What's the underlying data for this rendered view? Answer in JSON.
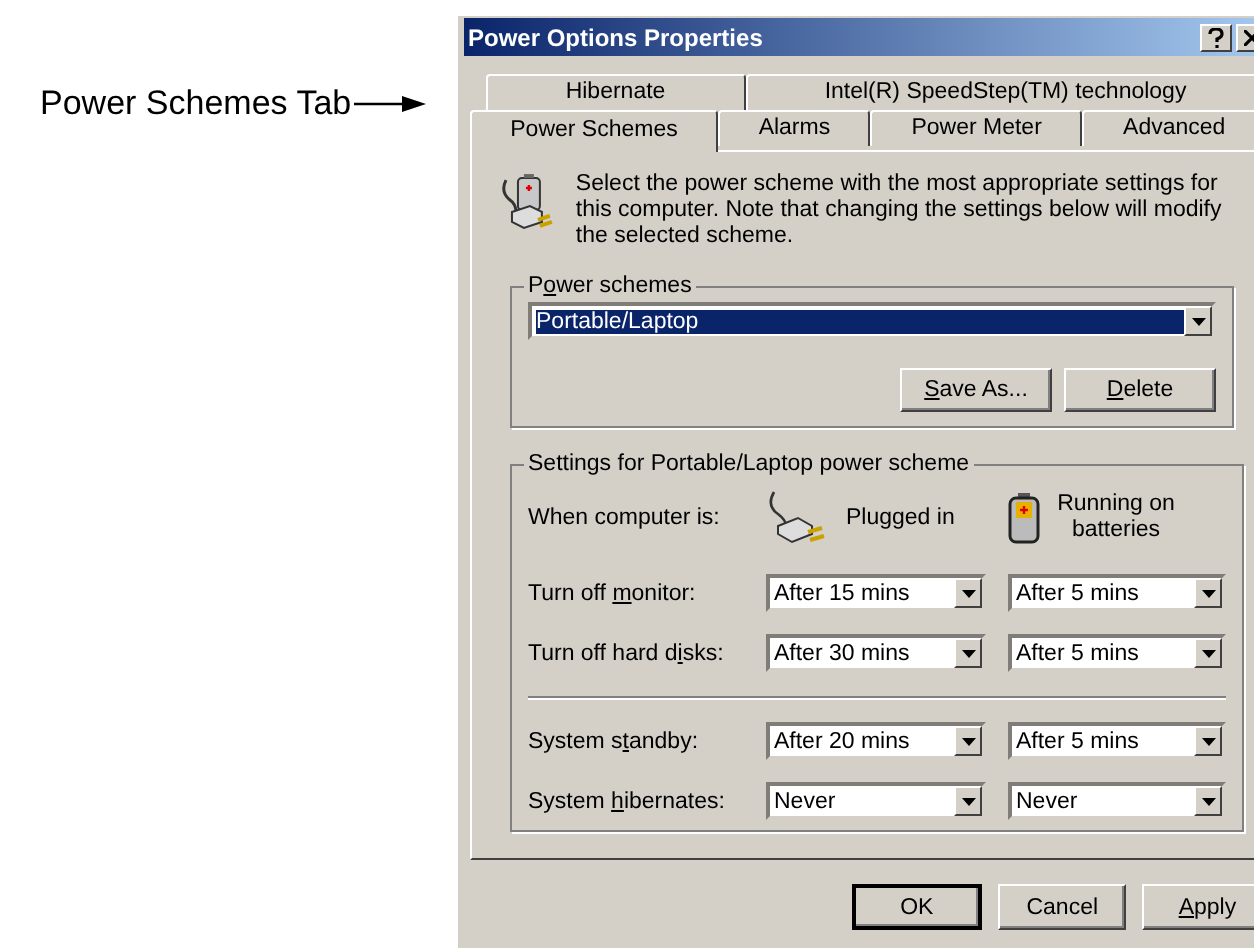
{
  "annotation": {
    "label": "Power Schemes Tab"
  },
  "window": {
    "title": "Power Options Properties"
  },
  "tab_rows": [
    [
      {
        "label": "Hibernate",
        "selected": false
      },
      {
        "label": "Intel(R) SpeedStep(TM) technology",
        "selected": false
      }
    ],
    [
      {
        "label": "Power Schemes",
        "selected": true
      },
      {
        "label": "Alarms",
        "selected": false
      },
      {
        "label": "Power Meter",
        "selected": false
      },
      {
        "label": "Advanced",
        "selected": false
      }
    ]
  ],
  "intro": "Select the power scheme with the most appropriate settings for this computer. Note that changing the settings below will modify the selected scheme.",
  "power_schemes": {
    "label_parts": [
      {
        "text": "P",
        "underlined": false
      },
      {
        "text": "o",
        "underlined": true
      },
      {
        "text": "wer schemes",
        "underlined": false
      }
    ],
    "value": "Portable/Laptop",
    "buttons": [
      {
        "label_parts": [
          {
            "text": "S",
            "underlined": true
          },
          {
            "text": "ave As...",
            "underlined": false
          }
        ]
      },
      {
        "label_parts": [
          {
            "text": "D",
            "underlined": true
          },
          {
            "text": "elete",
            "underlined": false
          }
        ]
      }
    ]
  },
  "settings": {
    "title": "Settings for Portable/Laptop power scheme",
    "header": {
      "label": "When computer is:",
      "plugged": "Plugged in",
      "battery": "Running on batteries"
    },
    "groups": [
      [
        {
          "label_parts": [
            {
              "text": "Turn off ",
              "underlined": false
            },
            {
              "text": "m",
              "underlined": true
            },
            {
              "text": "onitor:",
              "underlined": false
            }
          ],
          "plugged": "After 15 mins",
          "battery": "After 5 mins"
        },
        {
          "label_parts": [
            {
              "text": "Turn off hard d",
              "underlined": false
            },
            {
              "text": "i",
              "underlined": true
            },
            {
              "text": "sks:",
              "underlined": false
            }
          ],
          "plugged": "After 30 mins",
          "battery": "After 5 mins"
        }
      ],
      [
        {
          "label_parts": [
            {
              "text": "System s",
              "underlined": false
            },
            {
              "text": "t",
              "underlined": true
            },
            {
              "text": "andby:",
              "underlined": false
            }
          ],
          "plugged": "After 20 mins",
          "battery": "After 5 mins"
        },
        {
          "label_parts": [
            {
              "text": "System ",
              "underlined": false
            },
            {
              "text": "h",
              "underlined": true
            },
            {
              "text": "ibernates:",
              "underlined": false
            }
          ],
          "plugged": "Never",
          "battery": "Never"
        }
      ]
    ]
  },
  "buttons": [
    {
      "label_parts": [
        {
          "text": "OK",
          "underlined": false
        }
      ],
      "default": true
    },
    {
      "label_parts": [
        {
          "text": "Cancel",
          "underlined": false
        }
      ],
      "default": false
    },
    {
      "label_parts": [
        {
          "text": "A",
          "underlined": true
        },
        {
          "text": "pply",
          "underlined": false
        }
      ],
      "default": false
    }
  ]
}
